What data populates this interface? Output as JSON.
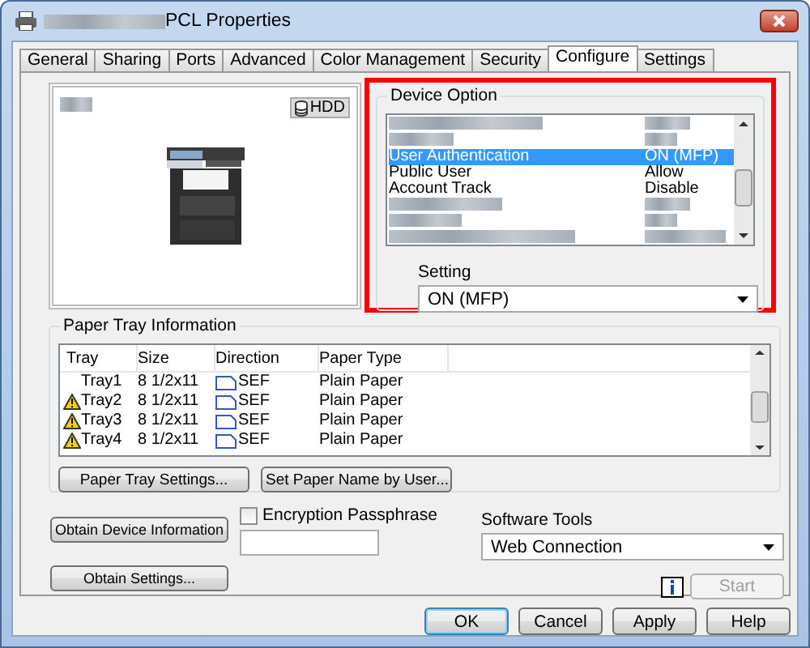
{
  "window": {
    "title": "PCL Properties"
  },
  "tabs": [
    {
      "label": "General",
      "selected": false
    },
    {
      "label": "Sharing",
      "selected": false
    },
    {
      "label": "Ports",
      "selected": false
    },
    {
      "label": "Advanced",
      "selected": false
    },
    {
      "label": "Color Management",
      "selected": false
    },
    {
      "label": "Security",
      "selected": false
    },
    {
      "label": "Configure",
      "selected": true
    },
    {
      "label": "Settings",
      "selected": false
    }
  ],
  "preview": {
    "hdd_label": "HDD"
  },
  "device_option": {
    "label": "Device Option",
    "rows": [
      {
        "name": "User Authentication",
        "value": "ON (MFP)",
        "selected": true
      },
      {
        "name": "Public User",
        "value": "Allow",
        "selected": false
      },
      {
        "name": "Account Track",
        "value": "Disable",
        "selected": false
      }
    ],
    "setting_label": "Setting",
    "setting_value": "ON (MFP)"
  },
  "paper_tray": {
    "label": "Paper Tray Information",
    "columns": [
      "Tray",
      "Size",
      "Direction",
      "Paper Type"
    ],
    "rows": [
      {
        "tray": "Tray1",
        "size": "8 1/2x11",
        "direction": "SEF",
        "paper_type": "Plain Paper",
        "warning": false
      },
      {
        "tray": "Tray2",
        "size": "8 1/2x11",
        "direction": "SEF",
        "paper_type": "Plain Paper",
        "warning": true
      },
      {
        "tray": "Tray3",
        "size": "8 1/2x11",
        "direction": "SEF",
        "paper_type": "Plain Paper",
        "warning": true
      },
      {
        "tray": "Tray4",
        "size": "8 1/2x11",
        "direction": "SEF",
        "paper_type": "Plain Paper",
        "warning": true
      }
    ],
    "buttons": [
      "Paper Tray Settings...",
      "Set Paper Name by User..."
    ]
  },
  "obtain_buttons": [
    "Obtain Device Information",
    "Obtain Settings..."
  ],
  "encryption": {
    "label": "Encryption Passphrase",
    "checked": false
  },
  "software_tools": {
    "label": "Software Tools",
    "value": "Web Connection"
  },
  "start_button": {
    "label": "Start",
    "disabled": true
  },
  "dialog_buttons": [
    {
      "label": "OK",
      "default": true
    },
    {
      "label": "Cancel",
      "default": false
    },
    {
      "label": "Apply",
      "default": false
    },
    {
      "label": "Help",
      "default": false
    }
  ]
}
